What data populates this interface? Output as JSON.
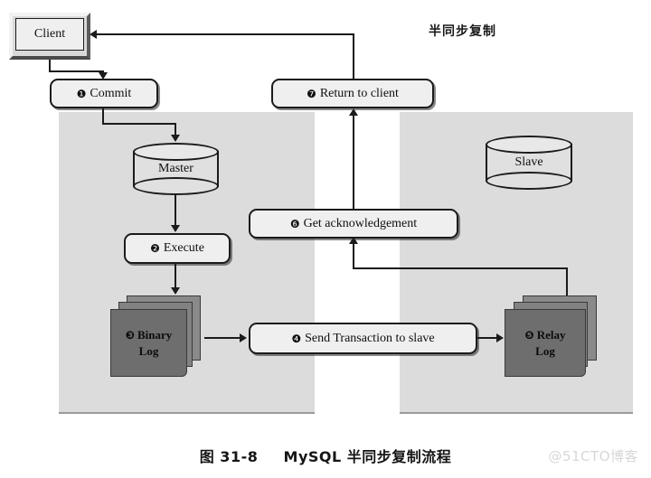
{
  "diagram": {
    "title": "半同步复制",
    "caption_label": "图 31-8",
    "caption_text": "MySQL 半同步复制流程",
    "watermark": "@51CTO博客"
  },
  "nodes": {
    "client": {
      "label": "Client"
    },
    "master_db": {
      "label": "Master"
    },
    "slave_db": {
      "label": "Slave"
    },
    "binary_log": {
      "num": "❸",
      "line1": "Binary",
      "line2": "Log"
    },
    "relay_log": {
      "num": "❺",
      "line1": "Relay",
      "line2": "Log"
    }
  },
  "steps": [
    {
      "num": "❶",
      "label": "Commit"
    },
    {
      "num": "❷",
      "label": "Execute"
    },
    {
      "num": "❸",
      "label": "Binary Log"
    },
    {
      "num": "❹",
      "label": "Send Transaction to slave"
    },
    {
      "num": "❺",
      "label": "Relay Log"
    },
    {
      "num": "❻",
      "label": "Get acknowledgement"
    },
    {
      "num": "❼",
      "label": "Return to client"
    }
  ],
  "step_boxes": {
    "commit": {
      "num": "❶",
      "label": "Commit"
    },
    "execute": {
      "num": "❷",
      "label": "Execute"
    },
    "send": {
      "num": "❹",
      "label": "Send Transaction to slave"
    },
    "getack": {
      "num": "❻",
      "label": "Get acknowledgement"
    },
    "ret": {
      "num": "❼",
      "label": "Return to client"
    }
  },
  "colors": {
    "panel": "#dcdcdc",
    "box_fill": "#efefef",
    "log_fill": "#6e6e6e",
    "stroke": "#1b1b1b"
  }
}
